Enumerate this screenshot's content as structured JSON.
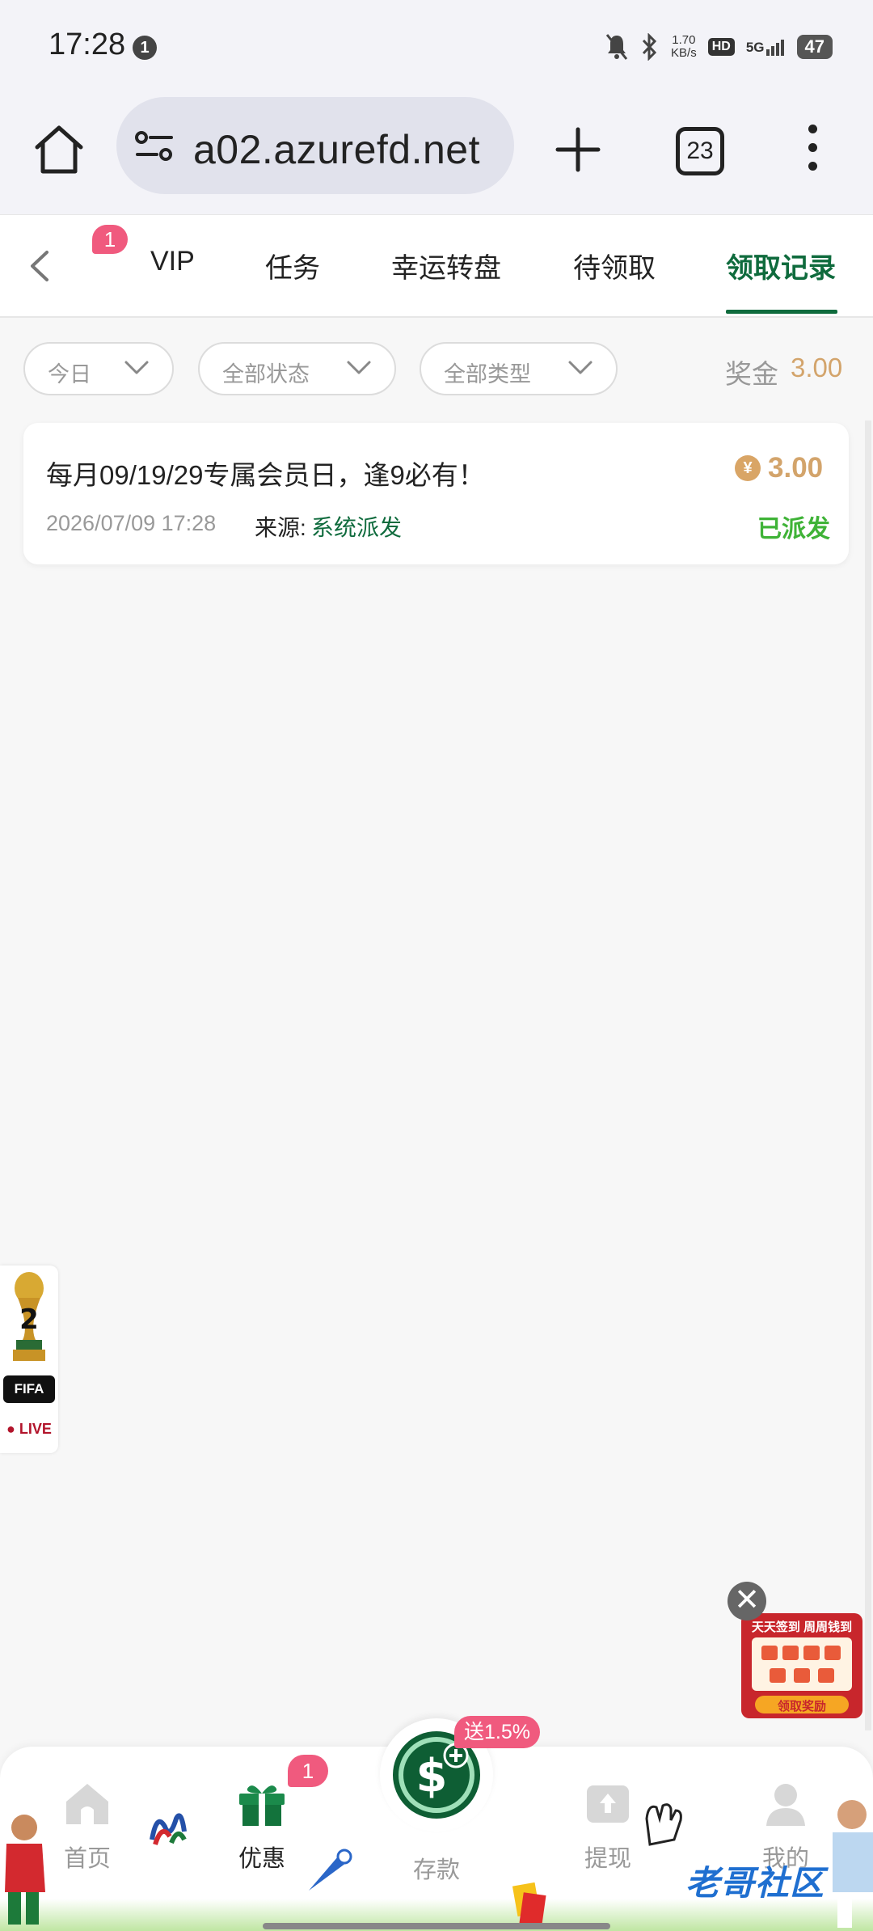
{
  "status_bar": {
    "time": "17:28",
    "notification_count": "1",
    "net_speed_value": "1.70",
    "net_speed_unit": "KB/s",
    "hd": "HD",
    "network": "5G",
    "battery": "47"
  },
  "browser": {
    "url": "a02.azurefd.net",
    "tab_count": "23",
    "icons": [
      "home-icon",
      "site-settings-icon",
      "new-tab-icon",
      "tab-switcher-icon",
      "more-menu-icon"
    ]
  },
  "tabs": {
    "badge": "1",
    "items": [
      "VIP",
      "任务",
      "幸运转盘",
      "待领取",
      "领取记录"
    ],
    "active": "领取记录"
  },
  "filters": {
    "date": "今日",
    "status": "全部状态",
    "type": "全部类型",
    "bonus_label": "奖金",
    "bonus_value": "3.00"
  },
  "records": [
    {
      "title": "每月09/19/29专属会员日，逢9必有！",
      "amount": "3.00",
      "coin_symbol": "¥",
      "time": "2026/07/09 17:28",
      "source_label": "来源:",
      "source_value": "系统派发",
      "status": "已派发"
    }
  ],
  "fifa_widget": {
    "badge": "FIFA",
    "live": "LIVE"
  },
  "promo": {
    "close": "✕",
    "title": "天天签到 周周钱到",
    "button": "领取奖励"
  },
  "bottom_nav": {
    "items": [
      "首页",
      "优惠",
      "存款",
      "提现",
      "我的"
    ],
    "active": "优惠",
    "promo_badge": "1",
    "deposit_tag": "送1.5%"
  },
  "watermark": "老哥社区",
  "colors": {
    "brand_green": "#0f6b3d",
    "gold": "#d3a46b",
    "status_green": "#3fb337",
    "badge_pink": "#f05a7e"
  }
}
